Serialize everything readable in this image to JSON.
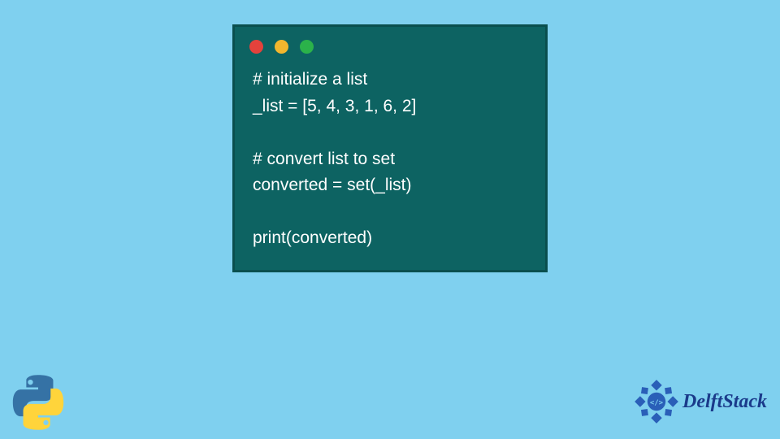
{
  "code": {
    "lines": [
      "# initialize a list",
      "_list = [5, 4, 3, 1, 6, 2]",
      "",
      "# convert list to set",
      "converted = set(_list)",
      "",
      "print(converted)"
    ]
  },
  "brand": {
    "name": "DelftStack"
  },
  "window": {
    "buttons": [
      "close",
      "minimize",
      "zoom"
    ]
  }
}
